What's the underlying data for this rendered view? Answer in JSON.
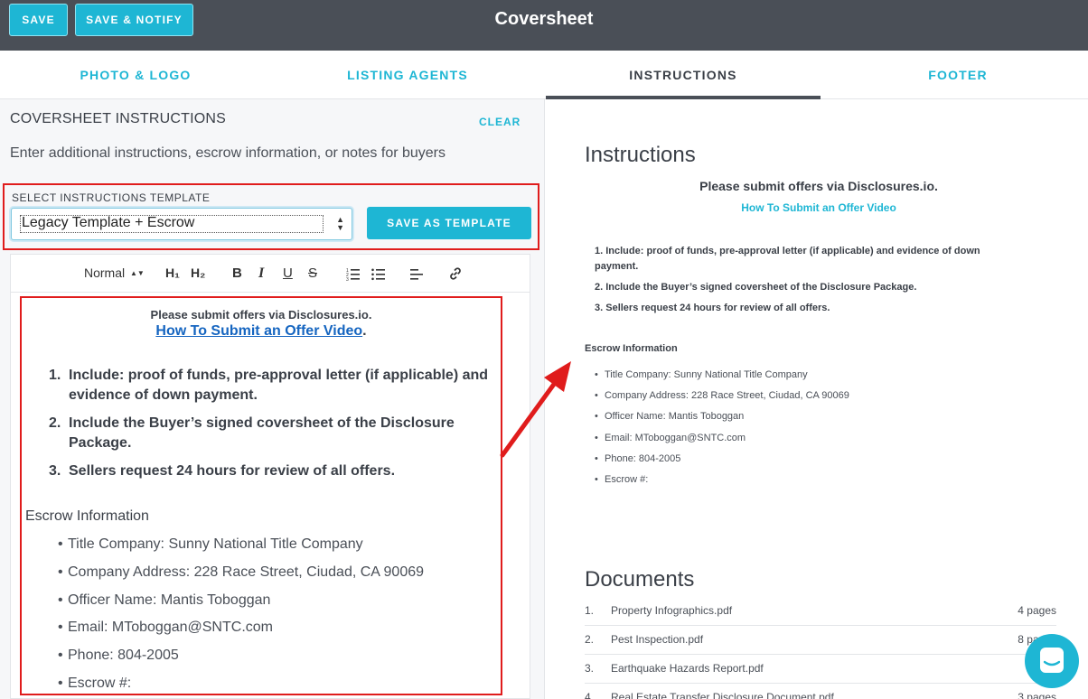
{
  "header": {
    "save_label": "SAVE",
    "save_notify_label": "SAVE & NOTIFY",
    "title": "Coversheet"
  },
  "tabs": [
    {
      "label": "PHOTO & LOGO",
      "active": false
    },
    {
      "label": "LISTING AGENTS",
      "active": false
    },
    {
      "label": "INSTRUCTIONS",
      "active": true
    },
    {
      "label": "FOOTER",
      "active": false
    }
  ],
  "left": {
    "section_title": "COVERSHEET INSTRUCTIONS",
    "clear_label": "CLEAR",
    "subtitle": "Enter additional instructions, escrow information, or notes for buyers",
    "template_label": "SELECT INSTRUCTIONS TEMPLATE",
    "template_selected": "Legacy Template + Escrow",
    "save_template_label": "SAVE AS TEMPLATE",
    "toolbar": {
      "format": "Normal",
      "h1": "H₁",
      "h2": "H₂",
      "bold": "B",
      "italic": "I",
      "underline": "U",
      "strike": "S"
    }
  },
  "content": {
    "line1": "Please submit offers via Disclosures.io.",
    "link": "How To Submit an Offer Video",
    "link_suffix": ".",
    "steps": [
      "Include: proof of funds, pre-approval letter (if applicable) and evidence of down payment.",
      "Include the Buyer’s signed coversheet of the Disclosure Package.",
      "Sellers request 24 hours for review of all offers."
    ],
    "escrow_title": "Escrow Information",
    "escrow_items": [
      "Title Company: Sunny National Title Company",
      "Company Address: 228 Race Street, Ciudad, CA 90069",
      "Officer Name: Mantis Toboggan",
      "Email: MToboggan@SNTC.com",
      "Phone: 804-2005",
      "Escrow #:"
    ]
  },
  "preview": {
    "instructions_heading": "Instructions",
    "documents_heading": "Documents",
    "documents": [
      {
        "num": "1.",
        "name": "Property Infographics.pdf",
        "pages": "4 pages"
      },
      {
        "num": "2.",
        "name": "Pest Inspection.pdf",
        "pages": "8 pages"
      },
      {
        "num": "3.",
        "name": "Earthquake Hazards Report.pdf",
        "pages": ""
      },
      {
        "num": "4.",
        "name": "Real Estate Transfer Disclosure Document.pdf",
        "pages": "3 pages"
      }
    ]
  },
  "colors": {
    "accent": "#1eb6d4",
    "header_bg": "#4a4f57",
    "highlight_red": "#e01c1c"
  },
  "icons": [
    "ordered-list-icon",
    "bullet-list-icon",
    "align-left-icon",
    "link-icon",
    "chat-icon",
    "arrow-annotation"
  ]
}
